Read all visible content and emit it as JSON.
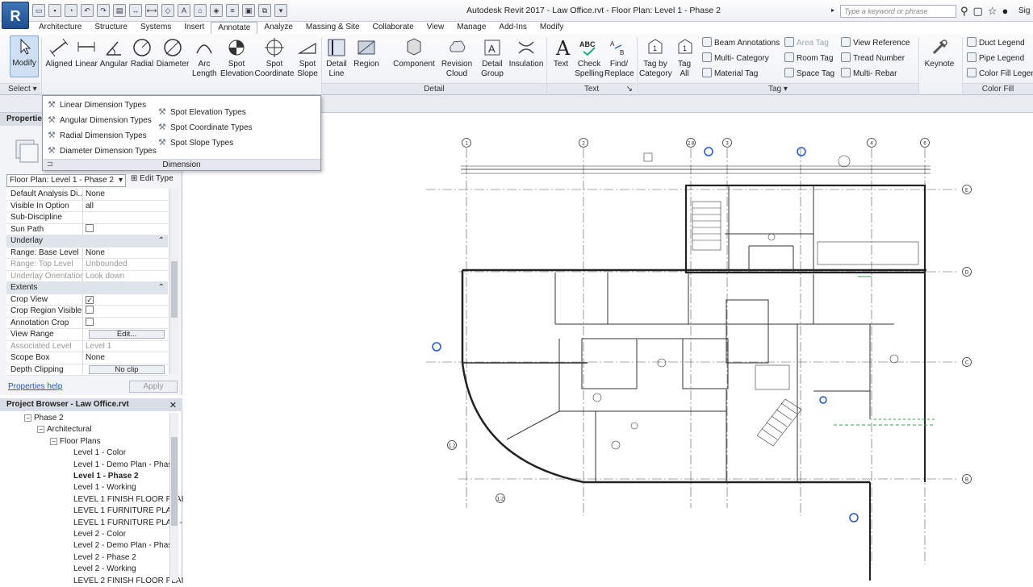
{
  "window": {
    "title": "Autodesk Revit 2017 -     Law Office.rvt - Floor Plan: Level 1 - Phase 2",
    "app_letter": "R",
    "search_placeholder": "Type a keyword or phrase",
    "user": "Sig"
  },
  "tabs": [
    "Architecture",
    "Structure",
    "Systems",
    "Insert",
    "Annotate",
    "Analyze",
    "Massing & Site",
    "Collaborate",
    "View",
    "Manage",
    "Add-Ins",
    "Modify"
  ],
  "active_tab": "Annotate",
  "ribbon": {
    "modify": "Modify",
    "select": "Select",
    "dimension_buttons": [
      {
        "l1": "Aligned",
        "l2": ""
      },
      {
        "l1": "Linear",
        "l2": ""
      },
      {
        "l1": "Angular",
        "l2": ""
      },
      {
        "l1": "Radial",
        "l2": ""
      },
      {
        "l1": "Diameter",
        "l2": ""
      },
      {
        "l1": "Arc",
        "l2": "Length"
      },
      {
        "l1": "Spot",
        "l2": "Elevation"
      },
      {
        "l1": "Spot",
        "l2": "Coordinate"
      },
      {
        "l1": "Spot",
        "l2": "Slope"
      }
    ],
    "detail_buttons": [
      {
        "l1": "Detail",
        "l2": "Line"
      },
      {
        "l1": "Region",
        "l2": ""
      },
      {
        "l1": "Component",
        "l2": ""
      },
      {
        "l1": "Revision",
        "l2": "Cloud"
      },
      {
        "l1": "Detail",
        "l2": "Group"
      },
      {
        "l1": "Insulation",
        "l2": ""
      }
    ],
    "detail_label": "Detail",
    "text_buttons": [
      {
        "l1": "Text",
        "l2": ""
      },
      {
        "l1": "Check",
        "l2": "Spelling"
      },
      {
        "l1": "Find/",
        "l2": "Replace"
      }
    ],
    "text_label": "Text",
    "tag_buttons": [
      {
        "l1": "Tag by",
        "l2": "Category"
      },
      {
        "l1": "Tag",
        "l2": "All"
      }
    ],
    "tag_small": [
      {
        "label": "Beam Annotations",
        "disabled": false
      },
      {
        "label": "Multi- Category",
        "disabled": false
      },
      {
        "label": "Material Tag",
        "disabled": false
      },
      {
        "label": "Area Tag",
        "disabled": true
      },
      {
        "label": "Room Tag",
        "disabled": false
      },
      {
        "label": "Space Tag",
        "disabled": false
      },
      {
        "label": "View Reference",
        "disabled": false
      },
      {
        "label": "Tread Number",
        "disabled": false
      },
      {
        "label": "Multi- Rebar",
        "disabled": false
      }
    ],
    "tag_label": "Tag",
    "keynote": "Keynote",
    "color_fill_small": [
      "Duct Legend",
      "Pipe Legend",
      "Color Fill Legend"
    ],
    "color_fill_label": "Color Fill"
  },
  "dimension_dropdown": {
    "left_items": [
      "Linear Dimension Types",
      "Angular Dimension Types",
      "Radial Dimension Types",
      "Diameter Dimension Types"
    ],
    "right_items": [
      "Spot Elevation Types",
      "Spot Coordinate Types",
      "Spot Slope Types"
    ],
    "label": "Dimension"
  },
  "properties": {
    "header": "Properties",
    "type_selector": "Floor Plan: Level 1 - Phase 2",
    "edit_type": "Edit Type",
    "rows": [
      {
        "kind": "row",
        "name": "Default Analysis Di...",
        "value": "None"
      },
      {
        "kind": "row",
        "name": "Visible In Option",
        "value": "all"
      },
      {
        "kind": "row",
        "name": "Sub-Discipline",
        "value": ""
      },
      {
        "kind": "check",
        "name": "Sun Path",
        "value": ""
      },
      {
        "kind": "group",
        "name": "Underlay"
      },
      {
        "kind": "row",
        "name": "Range: Base Level",
        "value": "None"
      },
      {
        "kind": "disabled",
        "name": "Range: Top Level",
        "value": "Unbounded"
      },
      {
        "kind": "disabled",
        "name": "Underlay Orientation",
        "value": "Look down"
      },
      {
        "kind": "group",
        "name": "Extents"
      },
      {
        "kind": "check",
        "name": "Crop View",
        "value": "✓"
      },
      {
        "kind": "check",
        "name": "Crop Region Visible",
        "value": ""
      },
      {
        "kind": "check",
        "name": "Annotation Crop",
        "value": ""
      },
      {
        "kind": "button",
        "name": "View Range",
        "value": "Edit..."
      },
      {
        "kind": "disabled",
        "name": "Associated Level",
        "value": "Level 1"
      },
      {
        "kind": "row",
        "name": "Scope Box",
        "value": "None"
      },
      {
        "kind": "button",
        "name": "Depth Clipping",
        "value": "No clip"
      }
    ],
    "help": "Properties help",
    "apply": "Apply"
  },
  "project_browser": {
    "header": "Project Browser - Law Office.rvt",
    "items": [
      {
        "label": "Phase 2",
        "indent": 0,
        "toggle": "−",
        "bold": false
      },
      {
        "label": "Architectural",
        "indent": 1,
        "toggle": "−",
        "bold": false
      },
      {
        "label": "Floor Plans",
        "indent": 2,
        "toggle": "−",
        "bold": false
      },
      {
        "label": "Level 1 - Color",
        "indent": 3,
        "toggle": "",
        "bold": false
      },
      {
        "label": "Level 1 - Demo Plan - Phase",
        "indent": 3,
        "toggle": "",
        "bold": false
      },
      {
        "label": "Level 1 - Phase 2",
        "indent": 3,
        "toggle": "",
        "bold": true
      },
      {
        "label": "Level 1 - Working",
        "indent": 3,
        "toggle": "",
        "bold": false
      },
      {
        "label": "LEVEL 1 FINISH FLOOR PLAI",
        "indent": 3,
        "toggle": "",
        "bold": false
      },
      {
        "label": "LEVEL 1 FURNITURE PLAN",
        "indent": 3,
        "toggle": "",
        "bold": false
      },
      {
        "label": "LEVEL 1 FURNITURE PLAN -",
        "indent": 3,
        "toggle": "",
        "bold": false
      },
      {
        "label": "Level 2 - Color",
        "indent": 3,
        "toggle": "",
        "bold": false
      },
      {
        "label": "Level 2 - Demo Plan - Phase",
        "indent": 3,
        "toggle": "",
        "bold": false
      },
      {
        "label": "Level 2 - Phase 2",
        "indent": 3,
        "toggle": "",
        "bold": false
      },
      {
        "label": "Level 2 - Working",
        "indent": 3,
        "toggle": "",
        "bold": false
      },
      {
        "label": "LEVEL 2 FINISH FLOOR PLAI",
        "indent": 3,
        "toggle": "",
        "bold": false
      }
    ]
  },
  "plan": {
    "grid_top": [
      "1",
      "2",
      "2.8",
      "3",
      "4",
      "6"
    ],
    "grid_right": [
      "E",
      "D",
      "C",
      "B"
    ],
    "grid_left": [
      "1.2",
      "1.2"
    ]
  }
}
